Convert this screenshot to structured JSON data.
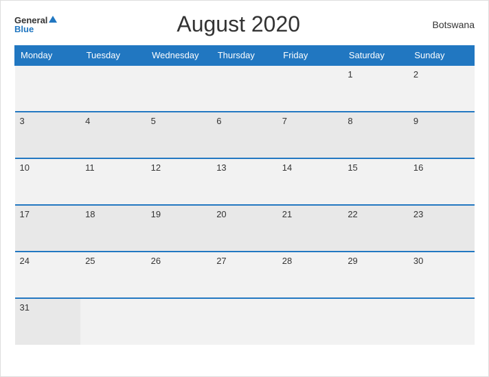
{
  "header": {
    "logo_general": "General",
    "logo_blue": "Blue",
    "title": "August 2020",
    "country": "Botswana"
  },
  "weekdays": [
    "Monday",
    "Tuesday",
    "Wednesday",
    "Thursday",
    "Friday",
    "Saturday",
    "Sunday"
  ],
  "weeks": [
    [
      {
        "day": "",
        "empty": true
      },
      {
        "day": "",
        "empty": true
      },
      {
        "day": "",
        "empty": true
      },
      {
        "day": "",
        "empty": true
      },
      {
        "day": "",
        "empty": true
      },
      {
        "day": "1",
        "empty": false
      },
      {
        "day": "2",
        "empty": false
      }
    ],
    [
      {
        "day": "3",
        "empty": false
      },
      {
        "day": "4",
        "empty": false
      },
      {
        "day": "5",
        "empty": false
      },
      {
        "day": "6",
        "empty": false
      },
      {
        "day": "7",
        "empty": false
      },
      {
        "day": "8",
        "empty": false
      },
      {
        "day": "9",
        "empty": false
      }
    ],
    [
      {
        "day": "10",
        "empty": false
      },
      {
        "day": "11",
        "empty": false
      },
      {
        "day": "12",
        "empty": false
      },
      {
        "day": "13",
        "empty": false
      },
      {
        "day": "14",
        "empty": false
      },
      {
        "day": "15",
        "empty": false
      },
      {
        "day": "16",
        "empty": false
      }
    ],
    [
      {
        "day": "17",
        "empty": false
      },
      {
        "day": "18",
        "empty": false
      },
      {
        "day": "19",
        "empty": false
      },
      {
        "day": "20",
        "empty": false
      },
      {
        "day": "21",
        "empty": false
      },
      {
        "day": "22",
        "empty": false
      },
      {
        "day": "23",
        "empty": false
      }
    ],
    [
      {
        "day": "24",
        "empty": false
      },
      {
        "day": "25",
        "empty": false
      },
      {
        "day": "26",
        "empty": false
      },
      {
        "day": "27",
        "empty": false
      },
      {
        "day": "28",
        "empty": false
      },
      {
        "day": "29",
        "empty": false
      },
      {
        "day": "30",
        "empty": false
      }
    ],
    [
      {
        "day": "31",
        "empty": false
      },
      {
        "day": "",
        "empty": true
      },
      {
        "day": "",
        "empty": true
      },
      {
        "day": "",
        "empty": true
      },
      {
        "day": "",
        "empty": true
      },
      {
        "day": "",
        "empty": true
      },
      {
        "day": "",
        "empty": true
      }
    ]
  ]
}
